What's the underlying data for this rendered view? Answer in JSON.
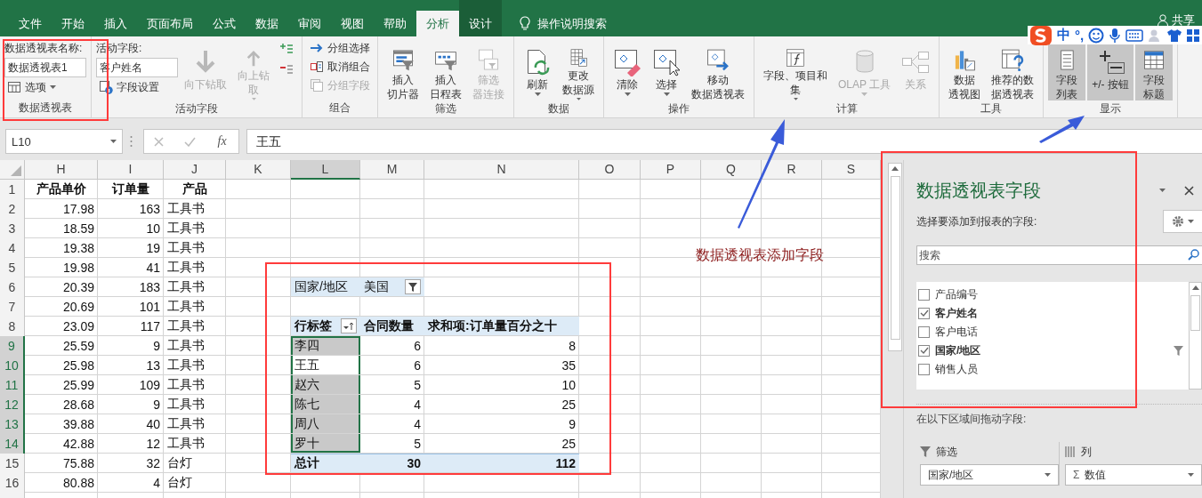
{
  "tabs": [
    {
      "label": "文件",
      "selected": false,
      "kind": "normal"
    },
    {
      "label": "开始",
      "selected": false,
      "kind": "normal"
    },
    {
      "label": "插入",
      "selected": false,
      "kind": "normal"
    },
    {
      "label": "页面布局",
      "selected": false,
      "kind": "normal"
    },
    {
      "label": "公式",
      "selected": false,
      "kind": "normal"
    },
    {
      "label": "数据",
      "selected": false,
      "kind": "normal"
    },
    {
      "label": "审阅",
      "selected": false,
      "kind": "normal"
    },
    {
      "label": "视图",
      "selected": false,
      "kind": "normal"
    },
    {
      "label": "帮助",
      "selected": false,
      "kind": "normal"
    },
    {
      "label": "分析",
      "selected": true,
      "kind": "normal"
    },
    {
      "label": "设计",
      "selected": false,
      "kind": "contextual"
    }
  ],
  "tell_me": "操作说明搜索",
  "share": "共享",
  "ime_toolbar": {
    "mode": "中",
    "punctuation": "°,"
  },
  "ribbon": [
    {
      "label": "数据透视表",
      "items": [
        {
          "kind": "caption",
          "text": "数据透视表名称:"
        },
        {
          "kind": "field",
          "value": "数据透视表1"
        },
        {
          "kind": "small",
          "label": "选项",
          "disabled": false,
          "dropdown": true
        }
      ]
    },
    {
      "label": "活动字段",
      "items": [
        {
          "kind": "caption",
          "text": "活动字段:"
        },
        {
          "kind": "field",
          "value": "客户姓名"
        },
        {
          "kind": "small",
          "label": "字段设置",
          "disabled": false,
          "dropdown": false
        },
        {
          "kind": "large",
          "lines": [
            "向下钻取"
          ],
          "disabled": true,
          "dropdown": false
        },
        {
          "kind": "large",
          "lines": [
            "向上钻",
            "取"
          ],
          "disabled": true,
          "dropdown": true
        },
        {
          "kind": "mini",
          "disabled": false
        },
        {
          "kind": "mini",
          "disabled": false
        }
      ]
    },
    {
      "label": "组合",
      "items": [
        {
          "kind": "small",
          "label": "分组选择",
          "disabled": false,
          "dropdown": false
        },
        {
          "kind": "small",
          "label": "取消组合",
          "disabled": false,
          "dropdown": false
        },
        {
          "kind": "small",
          "label": "分组字段",
          "disabled": true,
          "dropdown": false
        }
      ]
    },
    {
      "label": "筛选",
      "items": [
        {
          "kind": "large",
          "lines": [
            "插入",
            "切片器"
          ],
          "disabled": false,
          "dropdown": false
        },
        {
          "kind": "large",
          "lines": [
            "插入",
            "日程表"
          ],
          "disabled": false,
          "dropdown": false
        },
        {
          "kind": "large",
          "lines": [
            "筛选",
            "器连接"
          ],
          "disabled": true,
          "dropdown": false
        }
      ]
    },
    {
      "label": "数据",
      "items": [
        {
          "kind": "large",
          "lines": [
            "刷新"
          ],
          "disabled": false,
          "dropdown": true
        },
        {
          "kind": "large",
          "lines": [
            "更改",
            "数据源"
          ],
          "disabled": false,
          "dropdown": true
        }
      ]
    },
    {
      "label": "操作",
      "items": [
        {
          "kind": "large",
          "lines": [
            "清除"
          ],
          "disabled": false,
          "dropdown": true
        },
        {
          "kind": "large",
          "lines": [
            "选择"
          ],
          "disabled": false,
          "dropdown": true
        },
        {
          "kind": "large",
          "lines": [
            "移动",
            "数据透视表"
          ],
          "disabled": false,
          "dropdown": false
        }
      ]
    },
    {
      "label": "计算",
      "items": [
        {
          "kind": "large",
          "lines": [
            "字段、项目和",
            "集"
          ],
          "disabled": false,
          "dropdown": true
        },
        {
          "kind": "large",
          "lines": [
            "OLAP 工具"
          ],
          "disabled": true,
          "dropdown": true
        },
        {
          "kind": "large",
          "lines": [
            "关系"
          ],
          "disabled": true,
          "dropdown": false
        }
      ]
    },
    {
      "label": "工具",
      "items": [
        {
          "kind": "large",
          "lines": [
            "数据",
            "透视图"
          ],
          "disabled": false,
          "dropdown": false
        },
        {
          "kind": "large",
          "lines": [
            "推荐的数",
            "据透视表"
          ],
          "disabled": false,
          "dropdown": false
        }
      ]
    },
    {
      "label": "显示",
      "items": [
        {
          "kind": "large",
          "lines": [
            "字段",
            "列表"
          ],
          "disabled": false,
          "dropdown": false,
          "pressed": true
        },
        {
          "kind": "large",
          "lines": [
            "+/- 按钮"
          ],
          "disabled": false,
          "dropdown": false,
          "pressed": true
        },
        {
          "kind": "large",
          "lines": [
            "字段",
            "标题"
          ],
          "disabled": false,
          "dropdown": false,
          "pressed": true
        }
      ]
    }
  ],
  "name_box": "L10",
  "insert_function": "fx",
  "formula": "王五",
  "columns": [
    {
      "label": "H",
      "selected": false
    },
    {
      "label": "I",
      "selected": false
    },
    {
      "label": "J",
      "selected": false
    },
    {
      "label": "K",
      "selected": false
    },
    {
      "label": "L",
      "selected": true
    },
    {
      "label": "M",
      "selected": false
    },
    {
      "label": "N",
      "selected": false
    },
    {
      "label": "O",
      "selected": false
    },
    {
      "label": "P",
      "selected": false
    },
    {
      "label": "Q",
      "selected": false
    },
    {
      "label": "R",
      "selected": false
    },
    {
      "label": "S",
      "selected": false
    }
  ],
  "rows": [
    {
      "label": "1",
      "selected": false,
      "kind": "header",
      "cells": [
        "产品单价",
        "订单量",
        "产品"
      ]
    },
    {
      "label": "2",
      "selected": false,
      "kind": "data",
      "cells": [
        "17.98",
        "163",
        "工具书"
      ]
    },
    {
      "label": "3",
      "selected": false,
      "kind": "data",
      "cells": [
        "18.59",
        "10",
        "工具书"
      ]
    },
    {
      "label": "4",
      "selected": false,
      "kind": "data",
      "cells": [
        "19.38",
        "19",
        "工具书"
      ]
    },
    {
      "label": "5",
      "selected": false,
      "kind": "data",
      "cells": [
        "19.98",
        "41",
        "工具书"
      ]
    },
    {
      "label": "6",
      "selected": false,
      "kind": "data",
      "cells": [
        "20.39",
        "183",
        "工具书"
      ]
    },
    {
      "label": "7",
      "selected": false,
      "kind": "data",
      "cells": [
        "20.69",
        "101",
        "工具书"
      ]
    },
    {
      "label": "8",
      "selected": false,
      "kind": "data",
      "cells": [
        "23.09",
        "117",
        "工具书"
      ]
    },
    {
      "label": "9",
      "selected": true,
      "kind": "data",
      "cells": [
        "25.59",
        "9",
        "工具书"
      ]
    },
    {
      "label": "10",
      "selected": true,
      "kind": "data",
      "cells": [
        "25.98",
        "13",
        "工具书"
      ]
    },
    {
      "label": "11",
      "selected": true,
      "kind": "data",
      "cells": [
        "25.99",
        "109",
        "工具书"
      ]
    },
    {
      "label": "12",
      "selected": true,
      "kind": "data",
      "cells": [
        "28.68",
        "9",
        "工具书"
      ]
    },
    {
      "label": "13",
      "selected": true,
      "kind": "data",
      "cells": [
        "39.88",
        "40",
        "工具书"
      ]
    },
    {
      "label": "14",
      "selected": true,
      "kind": "data",
      "cells": [
        "42.88",
        "12",
        "工具书"
      ]
    },
    {
      "label": "15",
      "selected": false,
      "kind": "data",
      "cells": [
        "75.88",
        "32",
        "台灯"
      ]
    },
    {
      "label": "16",
      "selected": false,
      "kind": "data",
      "cells": [
        "80.88",
        "4",
        "台灯"
      ]
    }
  ],
  "pivot": {
    "filter": {
      "field": "国家/地区",
      "value": "美国"
    },
    "headers": [
      "行标签",
      "合同数量",
      "求和项:订单量百分之十"
    ],
    "rows": [
      {
        "label": "李四",
        "selected": true,
        "active": false,
        "values": [
          "6",
          "8"
        ]
      },
      {
        "label": "王五",
        "selected": true,
        "active": true,
        "values": [
          "6",
          "35"
        ]
      },
      {
        "label": "赵六",
        "selected": true,
        "active": false,
        "values": [
          "5",
          "10"
        ]
      },
      {
        "label": "陈七",
        "selected": true,
        "active": false,
        "values": [
          "4",
          "25"
        ]
      },
      {
        "label": "周八",
        "selected": true,
        "active": false,
        "values": [
          "4",
          "9"
        ]
      },
      {
        "label": "罗十",
        "selected": true,
        "active": false,
        "values": [
          "5",
          "25"
        ]
      }
    ],
    "total": {
      "label": "总计",
      "values": [
        "30",
        "112"
      ]
    }
  },
  "field_pane": {
    "title": "数据透视表字段",
    "subtitle": "选择要添加到报表的字段:",
    "search_placeholder": "搜索",
    "fields": [
      {
        "label": "产品编号",
        "checked": false,
        "filtered": false
      },
      {
        "label": "客户姓名",
        "checked": true,
        "filtered": false
      },
      {
        "label": "客户电话",
        "checked": false,
        "filtered": false
      },
      {
        "label": "国家/地区",
        "checked": true,
        "filtered": true
      },
      {
        "label": "销售人员",
        "checked": false,
        "filtered": false
      }
    ],
    "drag_hint": "在以下区域间拖动字段:",
    "areas": [
      {
        "kind": "filters",
        "label": "筛选",
        "value": "国家/地区"
      },
      {
        "kind": "columns",
        "label": "列",
        "symbol": "Σ",
        "value": "数值"
      }
    ]
  },
  "annotation": "数据透视表添加字段"
}
